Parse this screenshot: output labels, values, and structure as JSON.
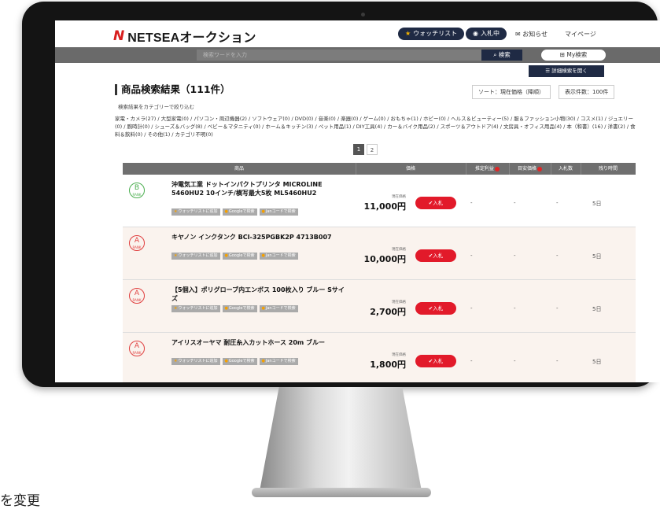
{
  "header": {
    "logo_mark": "N",
    "logo_text": "NETSEAオークション",
    "watchlist": "ウォッチリスト",
    "bidding": "入札中",
    "notice": "お知らせ",
    "mypage": "マイページ"
  },
  "search": {
    "placeholder": "検索ワードを入力",
    "button": "検索",
    "my_search": "My検索",
    "advanced": "詳細検索を開く"
  },
  "results": {
    "title": "商品検索結果（111件）",
    "sort": "ソート：現在価格（降順）",
    "per_page": "表示件数：100件",
    "narrow": "検索結果をカテゴリーで絞り込む",
    "categories": "家電・カメラ(27) / 大型家電(0) / パソコン・周辺機器(2) / ソフトウェア(0) / DVD(0) / 音楽(0) / 楽器(0) / ゲーム(0) / おもちゃ(1) / ホビー(0) / ヘルス＆ビューティー(5) / 服＆ファッション小物(30) / コスメ(1) / ジュエリー(0) / 腕時計(0) / シューズ＆バッグ(8) / ベビー＆マタニティ(0) / ホーム＆キッチン(3) / ペット用品(1) / DIY工具(4) / カー＆バイク用品(2) / スポーツ＆アウトドア(4) / 文房具・オフィス用品(4) / 本（和書）(16) / 洋書(2) / 食料＆飲料(0) / その他(1) / カテゴリ不明(0)",
    "pages": [
      "1",
      "2"
    ]
  },
  "table": {
    "headers": [
      "商品",
      "価格",
      "推定利益",
      "目安価格",
      "入札数",
      "残り時間"
    ],
    "rows": [
      {
        "rank": "B",
        "name": "沖電気工業 ドットインパクトプリンタ MICROLINE 5460HU2 10インチ/横写最大5枚 ML5460HU2",
        "price_label": "現在価格",
        "price": "11,000円",
        "profit": "-",
        "target": "-",
        "bids": "-",
        "time": "5日"
      },
      {
        "rank": "A",
        "name": "キヤノン インクタンク BCI-325PGBK2P 4713B007",
        "price_label": "現在価格",
        "price": "10,000円",
        "profit": "-",
        "target": "-",
        "bids": "-",
        "time": "5日"
      },
      {
        "rank": "A",
        "name": "【5個入】ポリグローブ内エンボス 100枚入り ブルー Sサイズ",
        "price_label": "現在価格",
        "price": "2,700円",
        "profit": "-",
        "target": "-",
        "bids": "-",
        "time": "5日"
      },
      {
        "rank": "A",
        "name": "アイリスオーヤマ 耐圧糸入カットホース 20m ブルー",
        "price_label": "現在価格",
        "price": "1,800円",
        "profit": "-",
        "target": "-",
        "bids": "-",
        "time": "5日"
      }
    ],
    "tag_watch": "ウォッチリストに追加",
    "tag_google": "Googleで検索",
    "tag_jan": "Janコードで検索",
    "bid_button": "入札",
    "rank_sub": "RANK"
  },
  "side_text": "を変更"
}
